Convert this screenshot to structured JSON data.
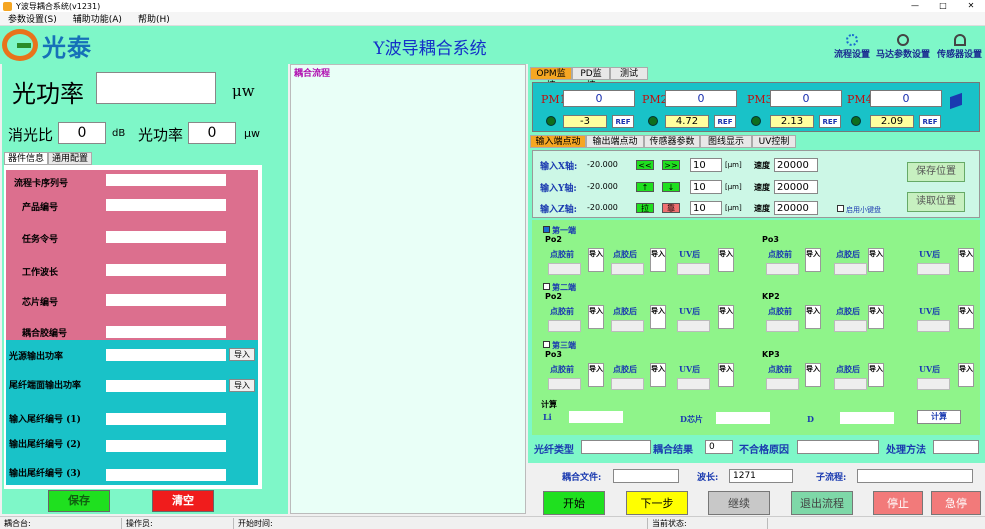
{
  "window": {
    "title": "Y波导耦合系统(v1231)"
  },
  "menu": [
    "参数设置(S)",
    "辅助功能(A)",
    "帮助(H)"
  ],
  "header": {
    "brand": "光泰",
    "title": "Y波导耦合系统",
    "buttons": [
      "流程设置",
      "马达参数设置",
      "传感器设置"
    ]
  },
  "left": {
    "power_label": "光功率",
    "power_unit": "μw",
    "extinction_label": "消光比",
    "extinction_value": "0",
    "extinction_unit": "dB",
    "power2_label": "光功率",
    "power2_value": "0",
    "power2_unit": "μw",
    "tabs": [
      "器件信息",
      "通用配置"
    ],
    "pink_fields": [
      "流程卡序列号",
      "产品编号",
      "任务令号",
      "工作波长",
      "芯片编号",
      "耦合胶编号"
    ],
    "teal_fields": [
      {
        "label": "光源输出功率",
        "btn": "导入"
      },
      {
        "label": "尾纤端面输出功率",
        "btn": "导入"
      },
      {
        "label": "输入尾纤编号 (1)"
      },
      {
        "label": "输出尾纤编号 (2)"
      },
      {
        "label": "输出尾纤编号 (3)"
      }
    ],
    "save": "保存",
    "clear": "清空"
  },
  "flow": {
    "title": "耦合流程"
  },
  "right": {
    "top_tabs": [
      "OPM监控",
      "PD监控",
      "测试"
    ],
    "pm": [
      {
        "label": "PM1",
        "value": "0",
        "reading": "-3",
        "ref": "REF"
      },
      {
        "label": "PM2",
        "value": "0",
        "reading": "4.72",
        "ref": "REF"
      },
      {
        "label": "PM3",
        "value": "0",
        "reading": "2.13",
        "ref": "REF"
      },
      {
        "label": "PM4",
        "value": "0",
        "reading": "2.09",
        "ref": "REF"
      }
    ],
    "mid_tabs": [
      "输入端点动",
      "输出端点动",
      "传感器参数",
      "图线显示",
      "UV控制"
    ],
    "axes": [
      {
        "label": "输入X轴:",
        "pos": "-20.000",
        "b1": "<<",
        "b2": ">>",
        "step": "10",
        "unit": "[μm]",
        "speed_label": "速度",
        "speed": "20000"
      },
      {
        "label": "输入Y轴:",
        "pos": "-20.000",
        "b1": "↑",
        "b2": "↓",
        "step": "10",
        "unit": "[μm]",
        "speed_label": "速度",
        "speed": "20000"
      },
      {
        "label": "输入Z轴:",
        "pos": "-20.000",
        "b1": "拉",
        "b2": "靠",
        "step": "10",
        "unit": "[μm]",
        "speed_label": "速度",
        "speed": "20000"
      }
    ],
    "save_pos": "保存位置",
    "read_pos": "读取位置",
    "keyboard": "启用小键盘",
    "sections": [
      {
        "check": "第一端",
        "left": "Po2",
        "right": "Po3"
      },
      {
        "check": "第二端",
        "left": "Po2",
        "right": "KP2"
      },
      {
        "check": "第三端",
        "left": "Po3",
        "right": "KP3"
      }
    ],
    "cols": [
      "点胶前",
      "点胶后",
      "UV后"
    ],
    "import": "导入",
    "calc": {
      "title": "计算",
      "li": "Li",
      "dchip": "D芯片",
      "d": "D",
      "btn": "计算"
    },
    "fiber_type": "光纤类型",
    "couple_result": "耦合结果",
    "result_value": "0",
    "fail_reason": "不合格原因",
    "method": "处理方法",
    "file_label": "耦合文件:",
    "wave_label": "波长:",
    "wave_value": "1271",
    "subflow_label": "子流程:",
    "buttons": {
      "start": "开始",
      "next": "下一步",
      "cont": "继续",
      "exit": "退出流程",
      "stop": "停止",
      "estop": "急停"
    }
  },
  "status": [
    "耦合台:",
    "操作员:",
    "开始时间:",
    "当前状态:"
  ],
  "colors": {
    "header": "#7ef7c8",
    "pink": "#dc6f8e",
    "teal": "#19c2c8",
    "green": "#8ff48a"
  }
}
